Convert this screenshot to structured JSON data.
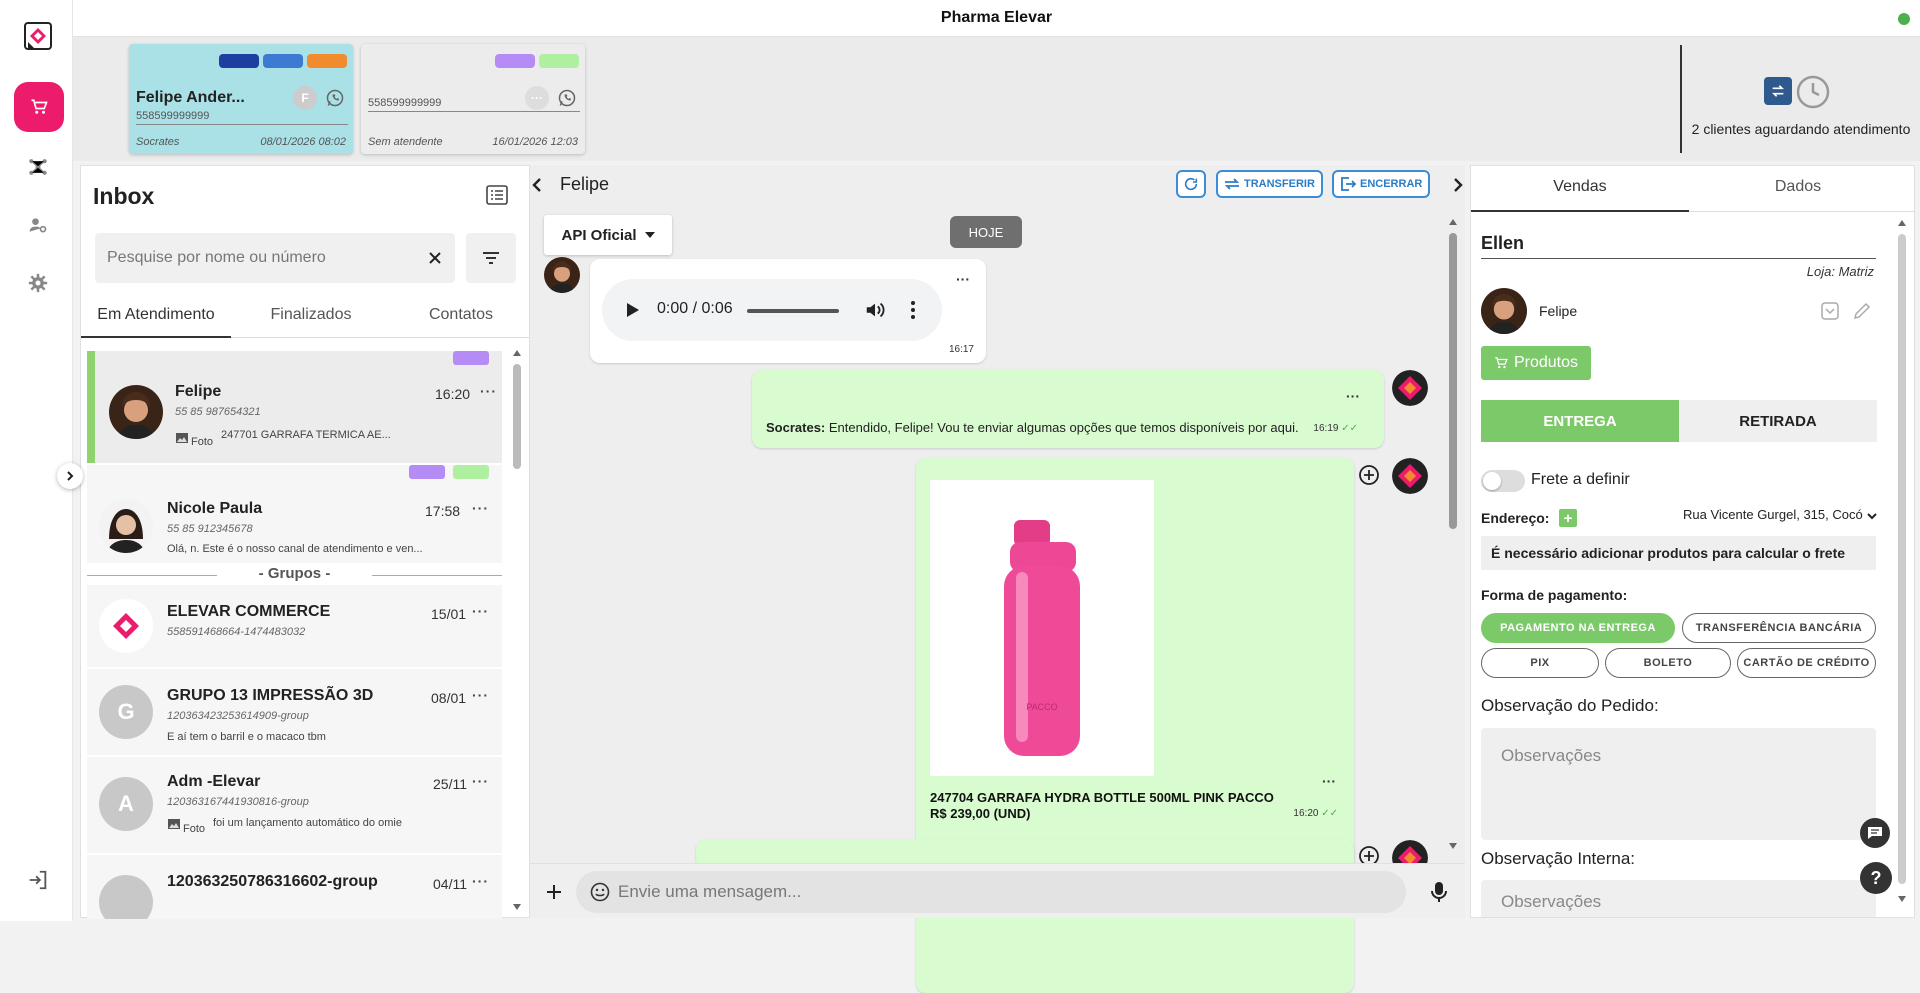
{
  "app": {
    "title": "Pharma Elevar"
  },
  "queue": {
    "cards": [
      {
        "name": "Felipe Ander...",
        "phone": "558599999999",
        "avatar_letter": "F",
        "agent": "Socrates",
        "date": "08/01/2026 08:02",
        "bg": "#a9e1e6",
        "tags": [
          "#1f3fa0",
          "#3d7bd3",
          "#f28a2e"
        ]
      },
      {
        "name": "",
        "phone": "558599999999",
        "avatar_letter": "···",
        "agent": "Sem atendente",
        "date": "16/01/2026 12:03",
        "bg": "#ececec",
        "tags": [
          "#b58cf5",
          "#aef0a0"
        ]
      }
    ],
    "waiting_text": "2 clientes aguardando atendimento"
  },
  "inbox": {
    "title": "Inbox",
    "search_placeholder": "Pesquise por nome ou número",
    "tabs": [
      "Em Atendimento",
      "Finalizados",
      "Contatos"
    ],
    "groups_label": "- Grupos -",
    "items": [
      {
        "name": "Felipe",
        "phone": "55 85 987654321",
        "time": "16:20",
        "photo_label": "Foto",
        "msg": "247701 GARRAFA TERMICA AE..."
      },
      {
        "name": "Nicole Paula",
        "phone": "55 85 912345678",
        "time": "17:58",
        "msg": "Olá, n. Este é o nosso canal de atendimento e ven..."
      },
      {
        "name": "ELEVAR COMMERCE",
        "phone": "558591468664-1474483032",
        "time": "15/01",
        "msg": ""
      },
      {
        "name": "GRUPO 13 IMPRESSÃO 3D",
        "phone": "120363423253614909-group",
        "time": "08/01",
        "letter": "G",
        "msg": "E aí tem o barril e o macaco tbm"
      },
      {
        "name": "Adm -Elevar",
        "phone": "120363167441930816-group",
        "time": "25/11",
        "letter": "A",
        "photo_label": "Foto",
        "msg": "foi um lançamento automático do omie"
      },
      {
        "name": "120363250786316602-group",
        "phone": "",
        "time": "04/11",
        "letter": "",
        "msg": ""
      }
    ],
    "dots": "···"
  },
  "chat": {
    "contact": "Felipe",
    "btn_transfer": "TRANSFERIR",
    "btn_close": "ENCERRAR",
    "api_label": "API Oficial",
    "date_badge": "HOJE",
    "audio": {
      "time": "0:00 / 0:06",
      "sent": "16:17"
    },
    "msg1": {
      "sender": "Socrates:",
      "text": "Entendido, Felipe! Vou te enviar algumas opções que temos disponíveis por aqui.",
      "time": "16:19"
    },
    "msg2": {
      "product_img_text": "PACCO",
      "caption1": "247704 GARRAFA HYDRA BOTTLE 500ML PINK PACCO",
      "caption2": "R$ 239,00 (UND)",
      "time": "16:20"
    },
    "composer_placeholder": "Envie uma mensagem...",
    "colors": {
      "out_bubble": "#d9fbd0",
      "accent_blue": "#3a8dd6"
    }
  },
  "panel": {
    "tabs": [
      "Vendas",
      "Dados"
    ],
    "seller": "Ellen",
    "loja": "Loja: Matriz",
    "client": "Felipe",
    "products_btn": "Produtos",
    "delivery": [
      "ENTREGA",
      "RETIRADA"
    ],
    "frete": "Frete a definir",
    "address_label": "Endereço:",
    "address_value": "Rua Vicente Gurgel, 315, Cocó",
    "warning": "É necessário adicionar produtos para calcular o frete",
    "payment_label": "Forma de pagamento:",
    "payments": [
      "PAGAMENTO NA ENTREGA",
      "TRANSFERÊNCIA BANCÁRIA",
      "PIX",
      "BOLETO",
      "CARTÃO DE CRÉDITO"
    ],
    "obs_label": "Observação do Pedido:",
    "obs_placeholder": "Observações",
    "obs_internal_label": "Observação Interna:",
    "obs_internal_placeholder": "Observações",
    "accent_green": "#7cc96a"
  }
}
